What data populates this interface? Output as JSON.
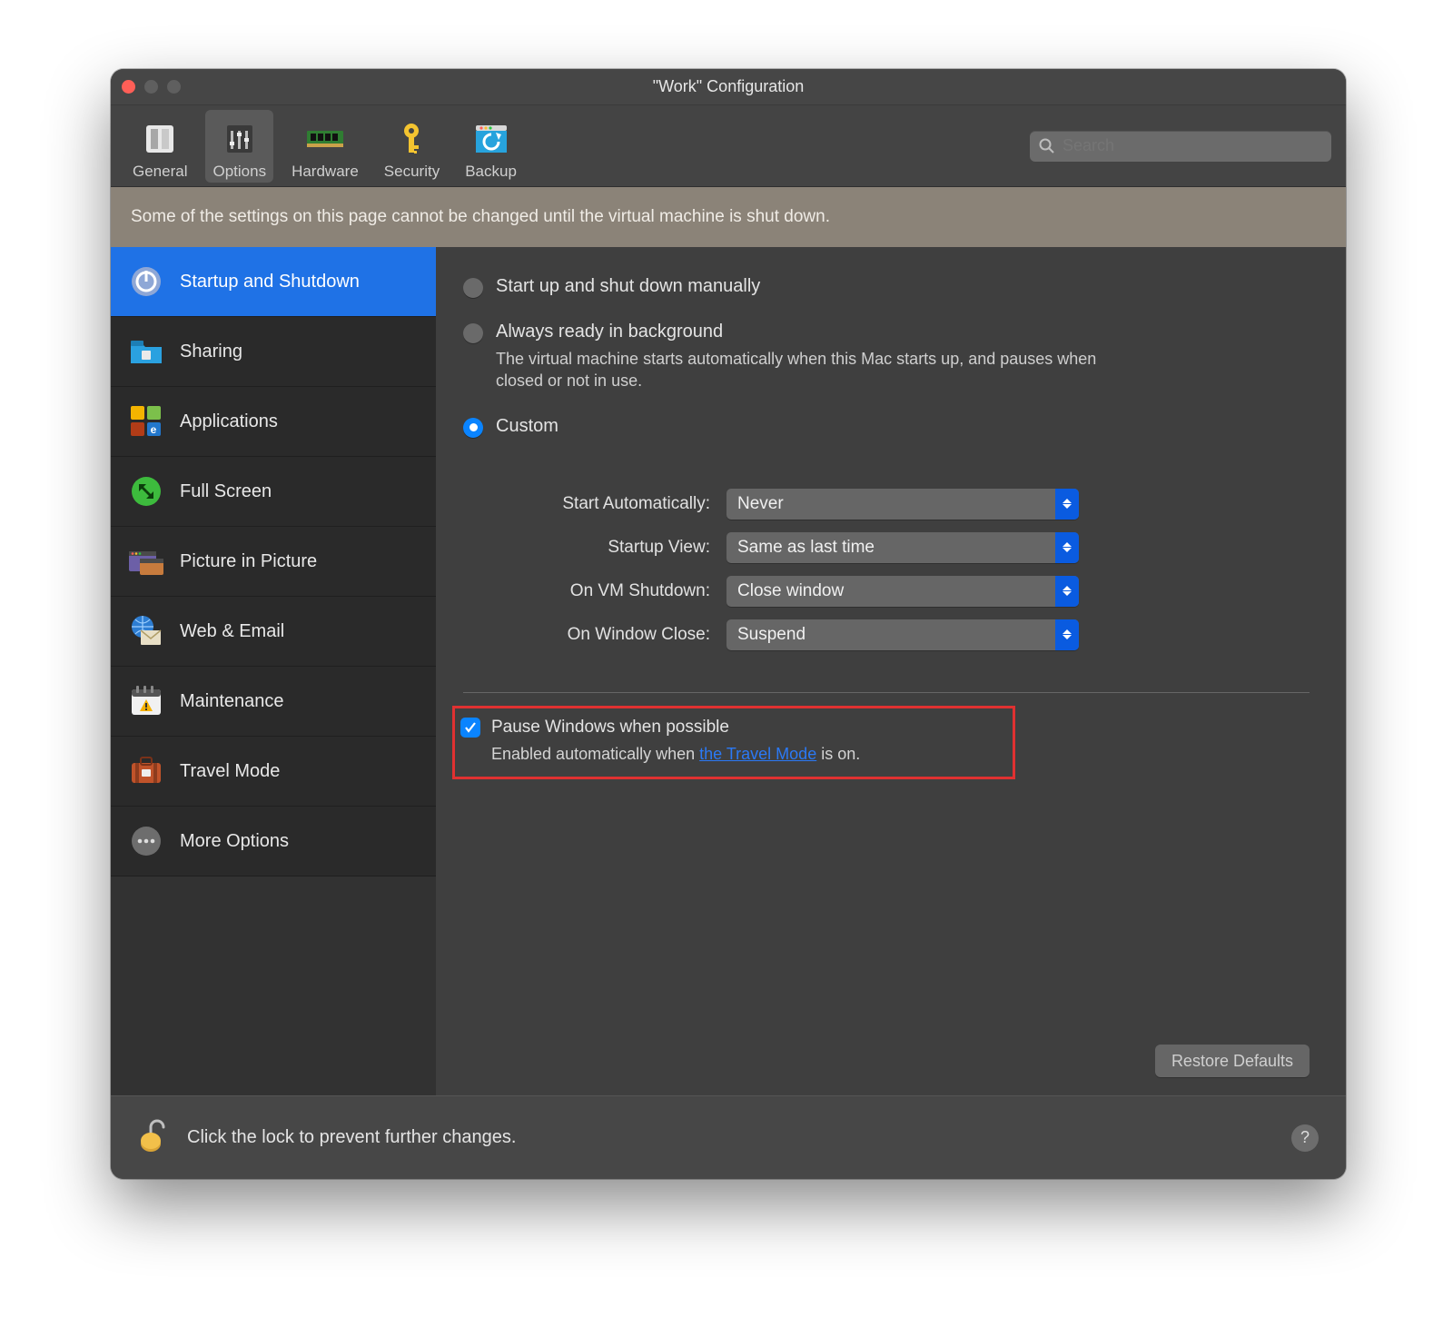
{
  "window_title": "\"Work\" Configuration",
  "toolbar": {
    "items": [
      {
        "label": "General"
      },
      {
        "label": "Options"
      },
      {
        "label": "Hardware"
      },
      {
        "label": "Security"
      },
      {
        "label": "Backup"
      }
    ],
    "selected": "Options"
  },
  "search": {
    "placeholder": "Search",
    "value": ""
  },
  "banner": "Some of the settings on this page cannot be changed until the virtual machine is shut down.",
  "sidebar": {
    "active": "Startup and Shutdown",
    "items": [
      {
        "name": "startup",
        "label": "Startup and Shutdown"
      },
      {
        "name": "sharing",
        "label": "Sharing"
      },
      {
        "name": "applications",
        "label": "Applications"
      },
      {
        "name": "fullscreen",
        "label": "Full Screen"
      },
      {
        "name": "pip",
        "label": "Picture in Picture"
      },
      {
        "name": "webemail",
        "label": "Web & Email"
      },
      {
        "name": "maintenance",
        "label": "Maintenance"
      },
      {
        "name": "travel",
        "label": "Travel Mode"
      },
      {
        "name": "more",
        "label": "More Options"
      }
    ]
  },
  "startup_mode": {
    "selected": "custom",
    "options": {
      "manual": {
        "label": "Start up and shut down manually"
      },
      "background": {
        "label": "Always ready in background",
        "sub": "The virtual machine starts automatically when this Mac starts up, and pauses when closed or not in use."
      },
      "custom": {
        "label": "Custom"
      }
    }
  },
  "custom_settings": {
    "rows": [
      {
        "label": "Start Automatically:",
        "value": "Never"
      },
      {
        "label": "Startup View:",
        "value": "Same as last time"
      },
      {
        "label": "On VM Shutdown:",
        "value": "Close window"
      },
      {
        "label": "On Window Close:",
        "value": "Suspend"
      }
    ]
  },
  "pause_option": {
    "checked": true,
    "label": "Pause Windows when possible",
    "sub_prefix": "Enabled automatically when ",
    "link_text": "the Travel Mode",
    "sub_suffix": " is on."
  },
  "restore_defaults": "Restore Defaults",
  "footer": {
    "lock_text": "Click the lock to prevent further changes.",
    "help": "?"
  }
}
